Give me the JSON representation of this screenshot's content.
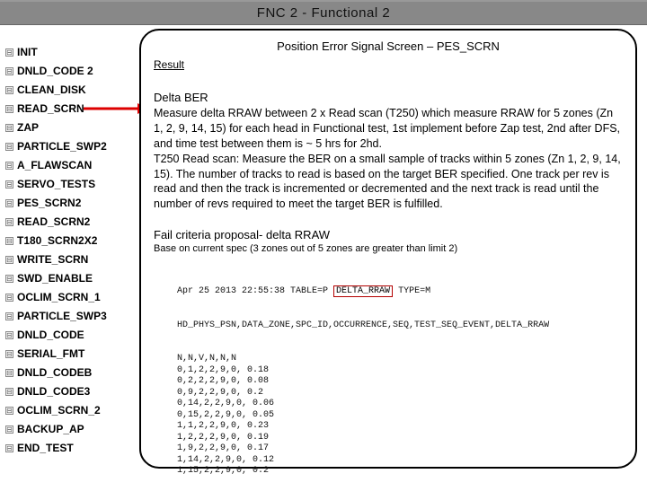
{
  "title_bar": "FNC 2 - Functional 2",
  "tree": {
    "collapse_glyph": "⊟",
    "items": [
      "INIT",
      "DNLD_CODE 2",
      "CLEAN_DISK",
      "READ_SCRN",
      "ZAP",
      "PARTICLE_SWP2",
      "A_FLAWSCAN",
      "SERVO_TESTS",
      "PES_SCRN2",
      "READ_SCRN2",
      "T180_SCRN2X2",
      "WRITE_SCRN",
      "SWD_ENABLE",
      "OCLIM_SCRN_1",
      "PARTICLE_SWP3",
      "DNLD_CODE",
      "SERIAL_FMT",
      "DNLD_CODEB",
      "DNLD_CODE3",
      "OCLIM_SCRN_2",
      "BACKUP_AP",
      "END_TEST"
    ]
  },
  "panel": {
    "title": "Position Error Signal Screen – PES_SCRN",
    "result_label": "Result",
    "body_heading": "Delta BER",
    "body_text": "Measure delta RRAW between 2 x Read scan (T250)  which measure RRAW for 5 zones (Zn 1, 2, 9, 14, 15) for each head in Functional test, 1st implement before Zap test, 2nd after DFS, and time test between them is ~ 5 hrs for 2hd.\nT250 Read scan: Measure the BER on a small sample of tracks within 5 zones (Zn 1, 2, 9, 14, 15). The number of tracks to read is based on the target BER specified. One track per rev is read and then the track is incremented or decremented and the next track is read until the number of revs required to meet the target BER is fulfilled.",
    "fail_heading": "Fail criteria proposal- delta RRAW",
    "fail_sub": "Base on current spec (3 zones out of 5 zones are greater than limit 2)",
    "log": {
      "hdr1_pre": "Apr 25 2013 22:55:38  TABLE=P",
      "hdr1_highlight": "DELTA_RRAW",
      "hdr1_post": " TYPE=M",
      "columns": "HD_PHYS_PSN,DATA_ZONE,SPC_ID,OCCURRENCE,SEQ,TEST_SEQ_EVENT,DELTA_RRAW",
      "rows": [
        "N,N,V,N,N,N",
        "0,1,2,2,9,0, 0.18",
        "0,2,2,2,9,0, 0.08",
        "0,9,2,2,9,0, 0.2",
        "0,14,2,2,9,0, 0.06",
        "0,15,2,2,9,0, 0.05",
        "1,1,2,2,9,0, 0.23",
        "1,2,2,2,9,0, 0.19",
        "1,9,2,2,9,0, 0.17",
        "1,14,2,2,9,0, 0.12",
        "1,15,2,2,9,0, 0.2"
      ]
    }
  }
}
